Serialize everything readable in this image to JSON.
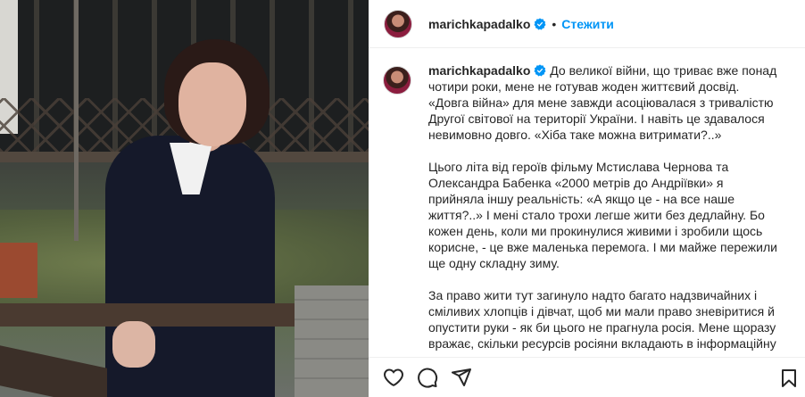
{
  "header": {
    "username": "marichkapadalko",
    "follow_label": "Стежити",
    "separator": "•"
  },
  "caption": {
    "username": "marichkapadalko",
    "paragraphs": [
      "До великої війни, що триває вже понад чотири роки, мене не готував жоден життєвий досвід. «Довга війна» для мене завжди асоціювалася з тривалістю Другої світової на території України. І навіть це здавалося невимовно довго. «Хіба таке можна витримати?..»",
      "Цього літа від героїв фільму Мстислава Чернова та Олександра Бабенка «2000 метрів до Андріївки» я прийняла іншу реальність: «А якщо це - на все наше життя?..» І мені стало трохи легше жити без дедлайну. Бо кожен день, коли ми прокинулися живими і зробили щось корисне, - це вже маленька перемога. І ми майже пережили ще одну складну зиму.",
      "За право жити тут загинуло надто багато надзвичайних і сміливих хлопців і дівчат, щоб ми мали право зневіритися й опустити руки - як би цього не прагнула росія. Мене щоразу вражає, скільки ресурсів росіяни вкладають в інформаційну"
    ]
  },
  "icons": {
    "verified": "verified-badge-icon",
    "more": "more-options-icon",
    "like": "heart-icon",
    "comment": "comment-icon",
    "share": "share-icon",
    "save": "bookmark-icon"
  },
  "colors": {
    "accent": "#0095f6",
    "text": "#262626",
    "border": "#efefef"
  }
}
